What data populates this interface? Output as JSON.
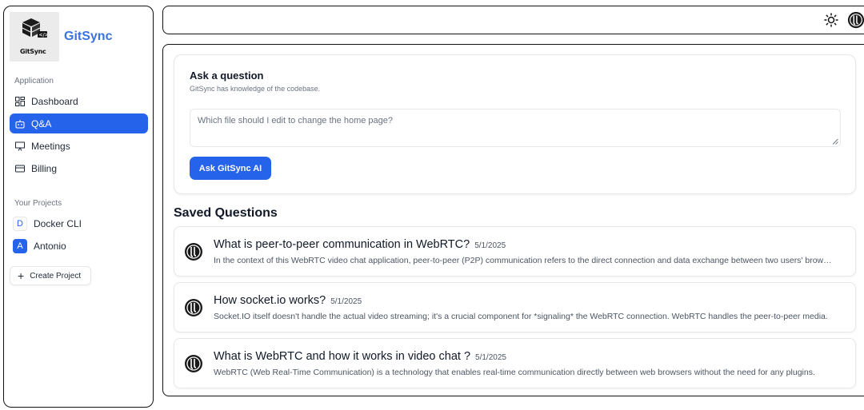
{
  "app": {
    "brand_name": "GitSync",
    "logo_text": "GitSync"
  },
  "sidebar": {
    "application_label": "Application",
    "nav_items": [
      {
        "label": "Dashboard",
        "icon": "dashboard-icon",
        "active": false
      },
      {
        "label": "Q&A",
        "icon": "bot-icon",
        "active": true
      },
      {
        "label": "Meetings",
        "icon": "presentation-icon",
        "active": false
      },
      {
        "label": "Billing",
        "icon": "credit-card-icon",
        "active": false
      }
    ],
    "projects_label": "Your Projects",
    "projects": [
      {
        "initial": "D",
        "name": "Docker CLI",
        "selected": false
      },
      {
        "initial": "A",
        "name": "Antonio",
        "selected": true
      }
    ],
    "create_project_label": "Create Project"
  },
  "topbar": {
    "icons": [
      "sun-icon",
      "user-avatar"
    ]
  },
  "ask": {
    "title": "Ask a question",
    "subtitle": "GitSync has knowledge of the codebase.",
    "placeholder": "Which file should I edit to change the home page?",
    "button_label": "Ask GitSync AI"
  },
  "saved": {
    "title": "Saved Questions",
    "items": [
      {
        "question": "What is peer-to-peer communication in WebRTC?",
        "date": "5/1/2025",
        "answer": "In the context of this WebRTC video chat application, peer-to-peer (P2P) communication refers to the direct connection and data exchange between two users' browsers."
      },
      {
        "question": "How socket.io works?",
        "date": "5/1/2025",
        "answer": "Socket.IO itself doesn't handle the actual video streaming; it's a crucial component for *signaling* the WebRTC connection. WebRTC handles the peer-to-peer media."
      },
      {
        "question": "What is WebRTC and how it works in video chat ?",
        "date": "5/1/2025",
        "answer": "WebRTC (Web Real-Time Communication) is a technology that enables real-time communication directly between web browsers without the need for any plugins."
      }
    ]
  },
  "colors": {
    "accent": "#2563eb",
    "brand": "#3b73e0"
  }
}
